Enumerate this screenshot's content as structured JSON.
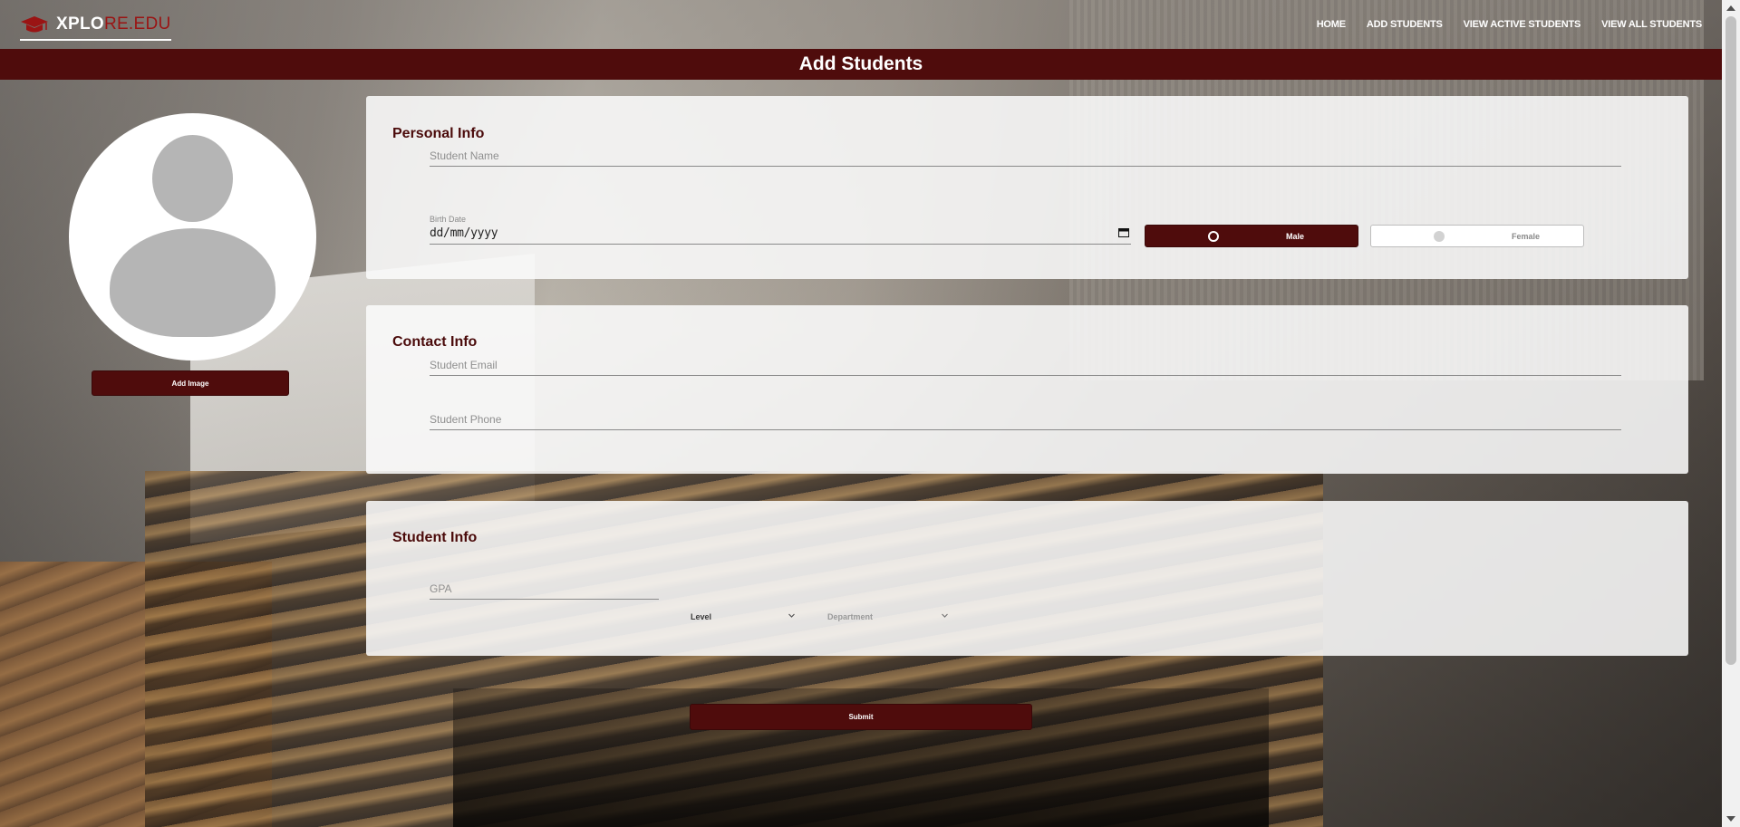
{
  "brand": {
    "part1": "XPLO",
    "part2": "RE.EDU"
  },
  "nav": {
    "items": [
      {
        "label": "HOME"
      },
      {
        "label": "ADD STUDENTS"
      },
      {
        "label": "VIEW ACTIVE STUDENTS"
      },
      {
        "label": "VIEW ALL STUDENTS"
      }
    ]
  },
  "page": {
    "title": "Add Students"
  },
  "avatar": {
    "add_image_label": "Add Image"
  },
  "personal": {
    "title": "Personal Info",
    "name_placeholder": "Student Name",
    "birth_label": "Birth Date",
    "birth_value": "dd/mm/yyyy",
    "gender": {
      "male_label": "Male",
      "female_label": "Female",
      "selected": "Male"
    }
  },
  "contact": {
    "title": "Contact Info",
    "email_placeholder": "Student Email",
    "phone_placeholder": "Student Phone"
  },
  "student": {
    "title": "Student Info",
    "gpa_placeholder": "GPA",
    "level_label": "Level",
    "department_label": "Department"
  },
  "submit_label": "Submit",
  "colors": {
    "brand_dark_red": "#4f0c0c",
    "brand_red": "#9a1414",
    "card_bg": "#fafafa",
    "placeholder_gray": "#8f8f8f"
  }
}
